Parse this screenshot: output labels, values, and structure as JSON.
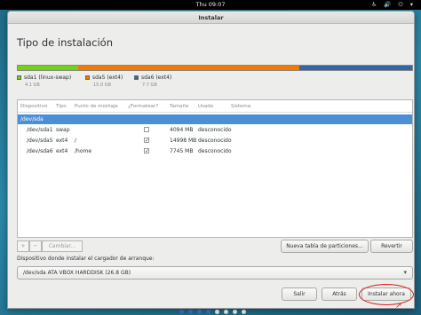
{
  "topbar": {
    "clock": "Thu 09:07",
    "icons": [
      "accessibility-icon",
      "volume-icon",
      "power-icon"
    ],
    "icon_glyphs": "♿ 🔊 ⏻ ▾"
  },
  "window": {
    "title": "Instalar",
    "heading": "Tipo de instalación"
  },
  "colors": {
    "swap": "#73d216",
    "ext4_a": "#f57900",
    "ext4_b": "#3465a4",
    "selection": "#4a90d9",
    "annotation": "#d81d1d"
  },
  "partitions_bar": [
    {
      "label": "sda1 (linux-swap)",
      "size": "4.1 GB",
      "color": "#73d216",
      "fraction": 0.153
    },
    {
      "label": "sda5 (ext4)",
      "size": "15.0 GB",
      "color": "#f57900",
      "fraction": 0.56
    },
    {
      "label": "sda6 (ext4)",
      "size": "7.7 GB",
      "color": "#3465a4",
      "fraction": 0.287
    }
  ],
  "table": {
    "headers": [
      "Dispositivo",
      "Tipo",
      "Punto de montaje",
      "¿Formatear?",
      "Tamaño",
      "Usado",
      "Sistema"
    ],
    "device": "/dev/sda",
    "rows": [
      {
        "device": "/dev/sda1",
        "type": "swap",
        "mount": "",
        "format": false,
        "size": "4094 MB",
        "used": "desconocido",
        "system": ""
      },
      {
        "device": "/dev/sda5",
        "type": "ext4",
        "mount": "/",
        "format": true,
        "size": "14998 MB",
        "used": "desconocido",
        "system": ""
      },
      {
        "device": "/dev/sda6",
        "type": "ext4",
        "mount": "/home",
        "format": true,
        "size": "7745 MB",
        "used": "desconocido",
        "system": ""
      }
    ]
  },
  "toolbar": {
    "add": "+",
    "remove": "−",
    "change": "Cambiar..."
  },
  "actions": {
    "new_table": "Nueva tabla de particiones...",
    "revert": "Revertir"
  },
  "bootloader": {
    "label": "Dispositivo donde instalar el cargador de arranque:",
    "value": "/dev/sda   ATA VBOX HARDDISK (26.8 GB)"
  },
  "buttons": {
    "quit": "Salir",
    "back": "Atrás",
    "install": "Instalar ahora"
  },
  "progress_dots": {
    "total": 8,
    "completed": 4
  }
}
